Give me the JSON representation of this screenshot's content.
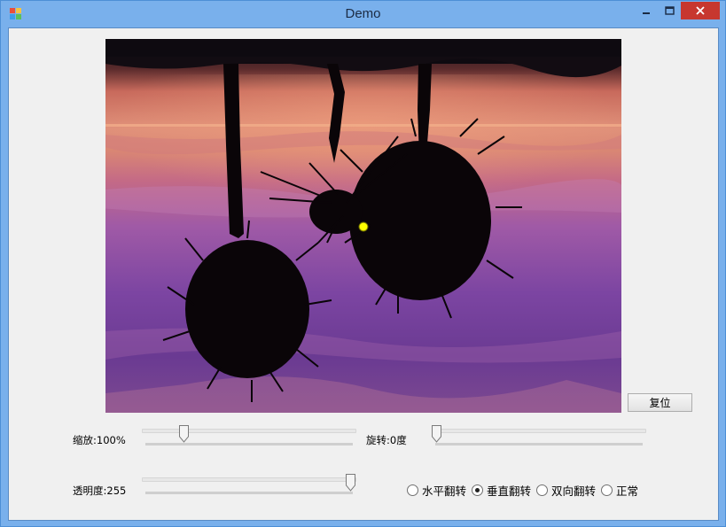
{
  "window": {
    "title": "Demo",
    "controls": {
      "minimize": "–",
      "maximize": "☐",
      "close": "✕"
    }
  },
  "image": {
    "scene": "sunset palm tree reflection, vertically flipped"
  },
  "reset_button": {
    "label": "复位"
  },
  "zoom": {
    "label": "缩放:100%",
    "value_fraction": 0.2
  },
  "rotate": {
    "label": "旋转:0度",
    "value_fraction": 0.0
  },
  "opacity": {
    "label": "透明度:255",
    "value_fraction": 1.0
  },
  "flip_options": {
    "selected": "垂直翻转",
    "items": [
      {
        "label": "水平翻转",
        "checked": false
      },
      {
        "label": "垂直翻转",
        "checked": true
      },
      {
        "label": "双向翻转",
        "checked": false
      },
      {
        "label": "正常",
        "checked": false
      }
    ]
  },
  "colors": {
    "titlebar": "#79b0ec",
    "close": "#c7372f",
    "client": "#f0f0f0",
    "marker": "#ffff00"
  }
}
